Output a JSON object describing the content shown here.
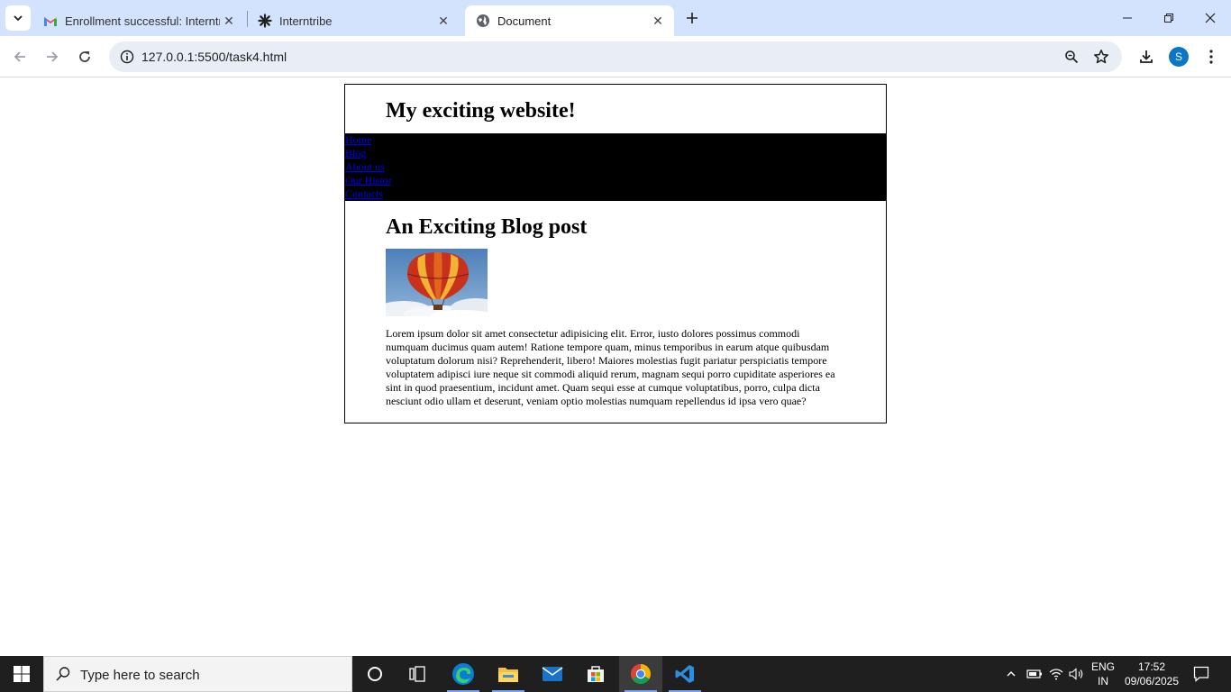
{
  "browser": {
    "tabs": [
      {
        "title": "Enrollment successful: Interntrib",
        "icon": "gmail-icon"
      },
      {
        "title": "Interntribe",
        "icon": "interntribe-icon"
      },
      {
        "title": "Document",
        "icon": "globe-icon",
        "active": true
      }
    ],
    "url": "127.0.0.1:5500/task4.html",
    "profile_initial": "S"
  },
  "page": {
    "site_title": "My exciting website!",
    "nav": [
      "Home",
      "Blog",
      "About us",
      "Our History",
      "Contacts"
    ],
    "post_title": "An Exciting Blog post",
    "post_image": "hot-air-balloon",
    "post_body": "Lorem ipsum dolor sit amet consectetur adipisicing elit. Error, iusto dolores possimus commodi numquam ducimus quam autem! Ratione tempore quam, minus temporibus in earum atque quibusdam voluptatum dolorum nisi? Reprehenderit, libero! Maiores molestias fugit pariatur perspiciatis tempore voluptatem adipisci iure neque sit commodi aliquid rerum, magnam sequi porro cupiditate asperiores ea sint in quod praesentium, incidunt amet. Quam sequi esse at cumque voluptatibus, porro, culpa dicta nesciunt odio ullam et deserunt, veniam optio molestias numquam repellendus id ipsa vero quae?"
  },
  "taskbar": {
    "search_placeholder": "Type here to search",
    "lang_line1": "ENG",
    "lang_line2": "IN",
    "time": "17:52",
    "date": "09/06/2025"
  },
  "colors": {
    "tabstrip": "#d3e3fd",
    "nav_background": "#000000",
    "link": "#0000ee",
    "taskbar": "#1f1f1f"
  }
}
